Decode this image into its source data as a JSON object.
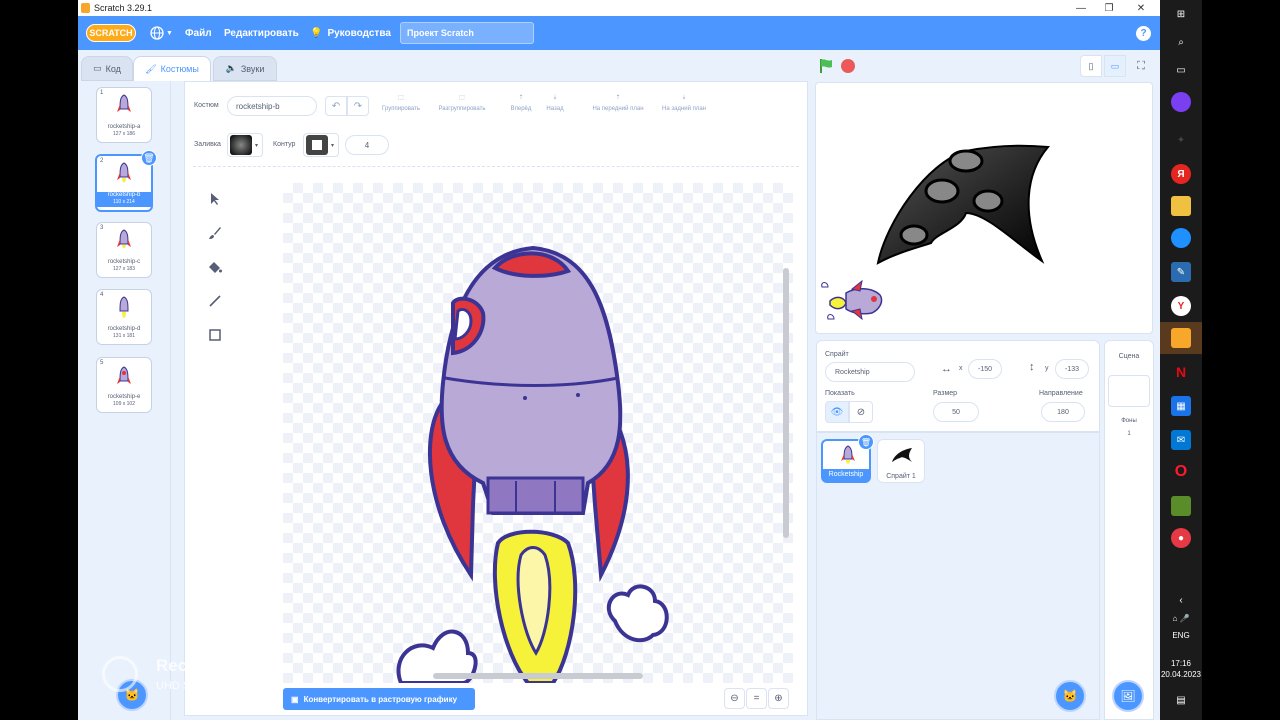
{
  "window": {
    "title": "Scratch 3.29.1"
  },
  "menu": {
    "logo": "SCRATCH",
    "file": "Файл",
    "edit": "Редактировать",
    "tutorials": "Руководства",
    "project_title": "Проект Scratch",
    "help": "?"
  },
  "tabs": {
    "code": "Код",
    "costumes": "Костюмы",
    "sounds": "Звуки"
  },
  "costumes": [
    {
      "num": "1",
      "name": "rocketship-a",
      "size": "127 x 186"
    },
    {
      "num": "2",
      "name": "rocketship-b",
      "size": "110 x 214"
    },
    {
      "num": "3",
      "name": "rocketship-c",
      "size": "127 x 183"
    },
    {
      "num": "4",
      "name": "rocketship-d",
      "size": "131 x 181"
    },
    {
      "num": "5",
      "name": "rocketship-e",
      "size": "109 x 102"
    }
  ],
  "editor": {
    "costume_label": "Костюм",
    "costume_name": "rocketship-b",
    "group": "Группировать",
    "ungroup": "Разгруппировать",
    "forward": "Вперёд",
    "backward": "Назад",
    "front": "На передний план",
    "back": "На задний план",
    "fill_label": "Заливка",
    "outline_label": "Контур",
    "outline_width": "4",
    "convert": "Конвертировать в растровую графику"
  },
  "sprite": {
    "label": "Спрайт",
    "name": "Rocketship",
    "x_label": "x",
    "x": "-150",
    "y_label": "y",
    "y": "-133",
    "show_label": "Показать",
    "size_label": "Размер",
    "size": "50",
    "direction_label": "Направление",
    "direction": "180"
  },
  "sprites": [
    {
      "name": "Rocketship",
      "selected": true
    },
    {
      "name": "Спрайт 1",
      "selected": false
    }
  ],
  "stage_pane": {
    "title": "Сцена",
    "backdrops_label": "Фоны",
    "backdrops_count": "1"
  },
  "watermark": {
    "title": "RecForth",
    "subtitle": "UHD Screen Recorder"
  },
  "system": {
    "lang": "ENG",
    "time": "17:16",
    "date": "20.04.2023"
  },
  "colors": {
    "accent": "#4c97ff",
    "menu": "#4c97ff",
    "rocket_body": "#b9a9d6",
    "rocket_outline": "#3b3494",
    "rocket_fin": "#e0363e",
    "flame": "#f6f23a"
  }
}
